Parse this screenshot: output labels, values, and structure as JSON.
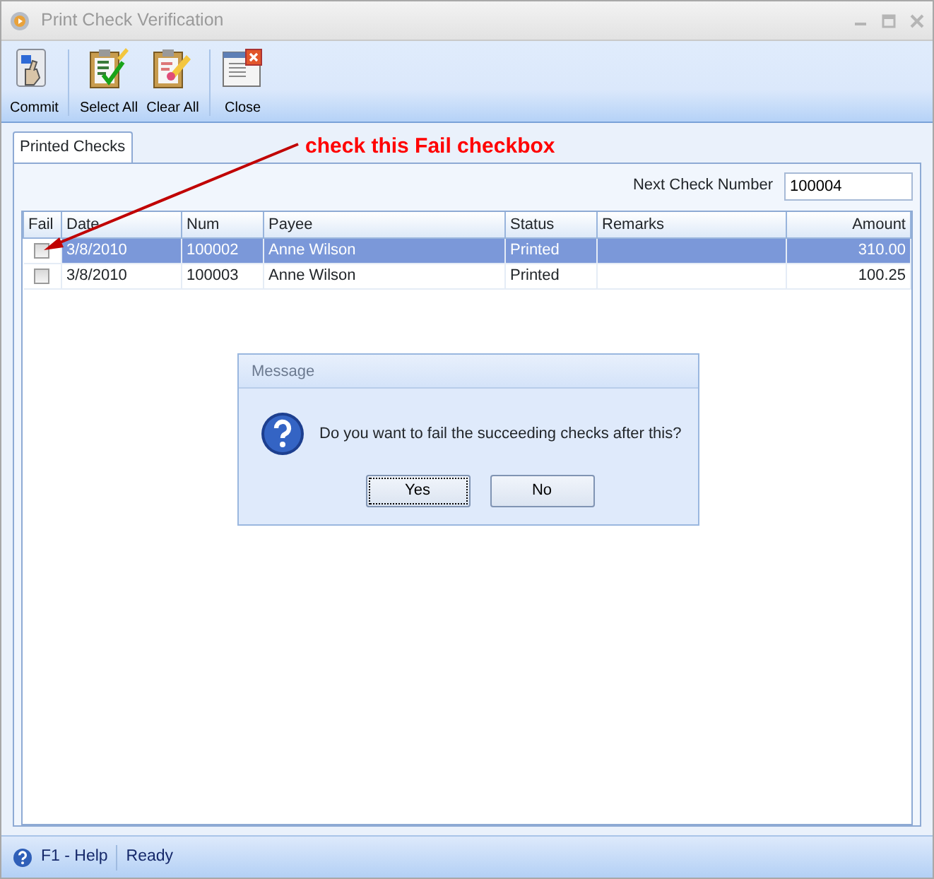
{
  "window": {
    "title": "Print Check Verification"
  },
  "toolbar": [
    {
      "label": "Commit",
      "kind": "commit",
      "separator_after": true
    },
    {
      "label": "Select All",
      "kind": "select",
      "separator_after": false
    },
    {
      "label": "Clear All",
      "kind": "clear",
      "separator_after": true
    },
    {
      "label": "Close",
      "kind": "close",
      "separator_after": false
    }
  ],
  "tabs": [
    {
      "label": "Printed Checks",
      "selected": true
    }
  ],
  "annotation": {
    "text": "check this Fail checkbox"
  },
  "next_check_number": {
    "label": "Next Check Number",
    "value": "100004"
  },
  "table": {
    "columns": [
      "Fail",
      "Date",
      "Num",
      "Payee",
      "Status",
      "Remarks",
      "Amount"
    ],
    "rows": [
      {
        "fail": false,
        "selected": true,
        "cells": [
          "",
          "3/8/2010",
          "100002",
          "Anne Wilson",
          "Printed",
          "",
          "310.00"
        ]
      },
      {
        "fail": false,
        "selected": false,
        "cells": [
          "",
          "3/8/2010",
          "100003",
          "Anne Wilson",
          "Printed",
          "",
          "100.25"
        ]
      }
    ]
  },
  "dialog": {
    "title": "Message",
    "message": "Do you want to fail the succeeding checks after this?",
    "buttons": [
      {
        "label": "Yes",
        "focused": true
      },
      {
        "label": "No",
        "focused": false
      }
    ]
  },
  "status_bar": {
    "help": "F1 - Help",
    "status": "Ready"
  }
}
